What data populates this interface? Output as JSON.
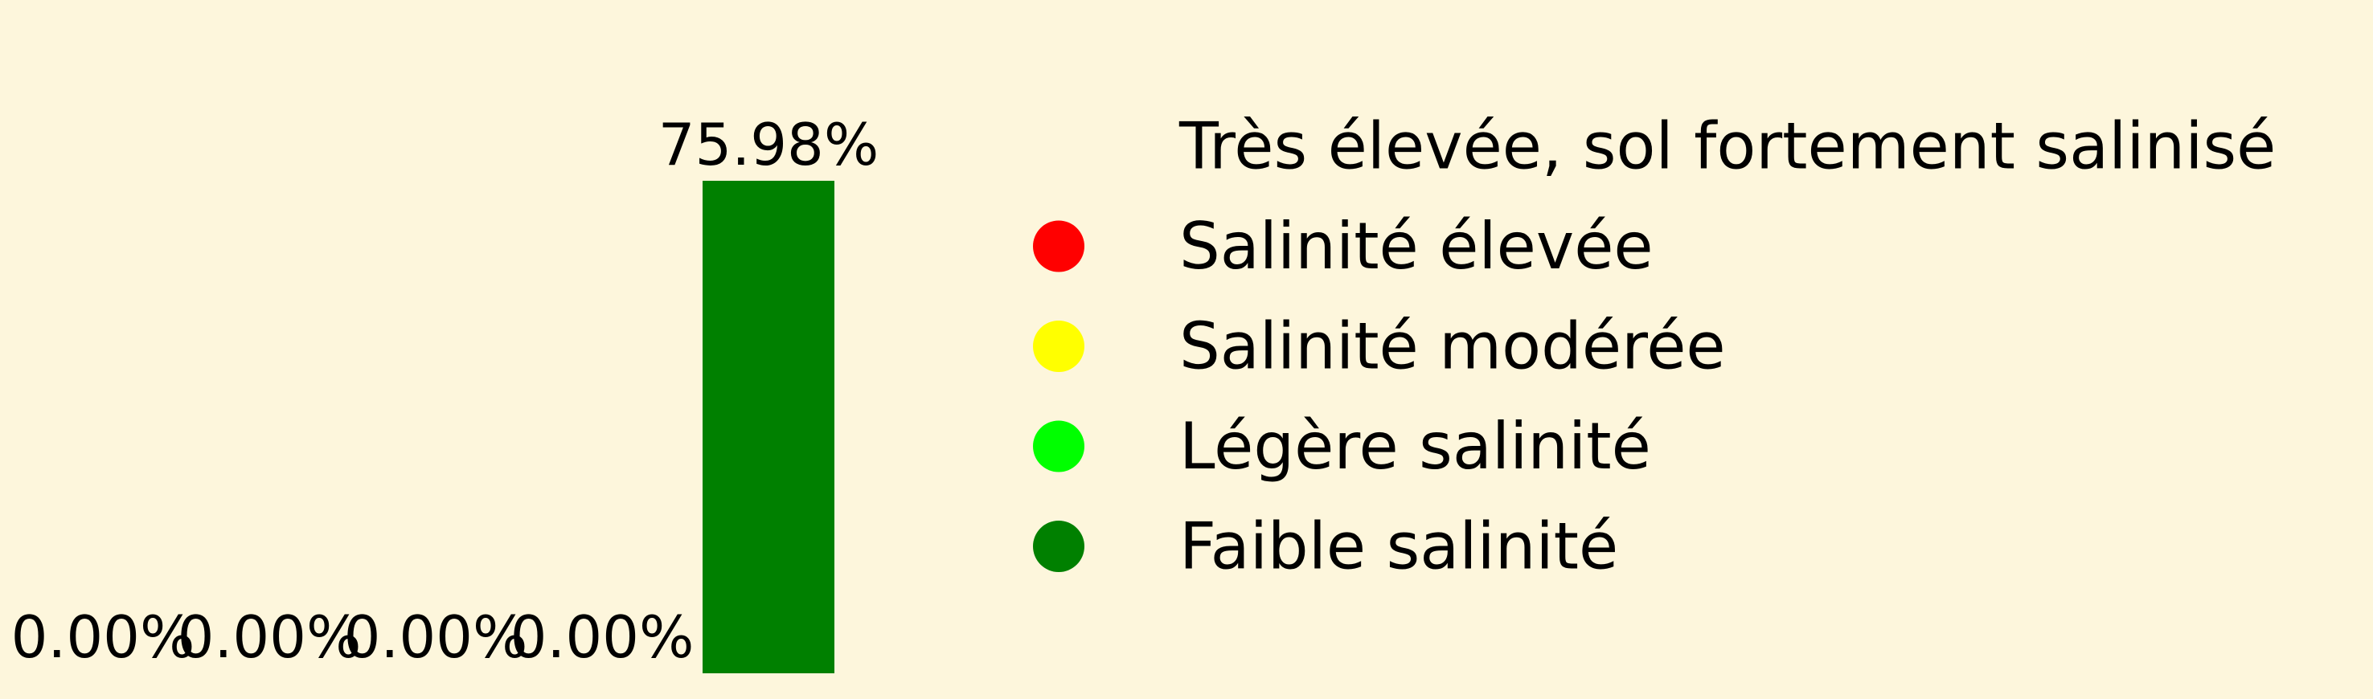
{
  "chart_data": {
    "type": "bar",
    "categories": [
      "Très élevée, sol fortement salinisé",
      "Salinité élevée",
      "Salinité modérée",
      "Légère salinité",
      "Faible salinité"
    ],
    "values": [
      0.0,
      0.0,
      0.0,
      0.0,
      75.98
    ],
    "data_labels": [
      "0.00%",
      "0.00%",
      "0.00%",
      "0.00%",
      "75.98%"
    ],
    "colors": [
      "#fdf6dc",
      "#ff0000",
      "#ffff00",
      "#00ff00",
      "#008000"
    ],
    "ylim": [
      0,
      75.98
    ],
    "grid": false,
    "axes_visible": false,
    "legend": {
      "position": "right",
      "entries": [
        "Très élevée, sol fortement salinisé",
        "Salinité élevée",
        "Salinité modérée",
        "Légère salinité",
        "Faible salinité"
      ]
    },
    "title": "",
    "xlabel": "",
    "ylabel": ""
  },
  "colors": {
    "background": "#fdf6dc",
    "text": "#000000"
  }
}
